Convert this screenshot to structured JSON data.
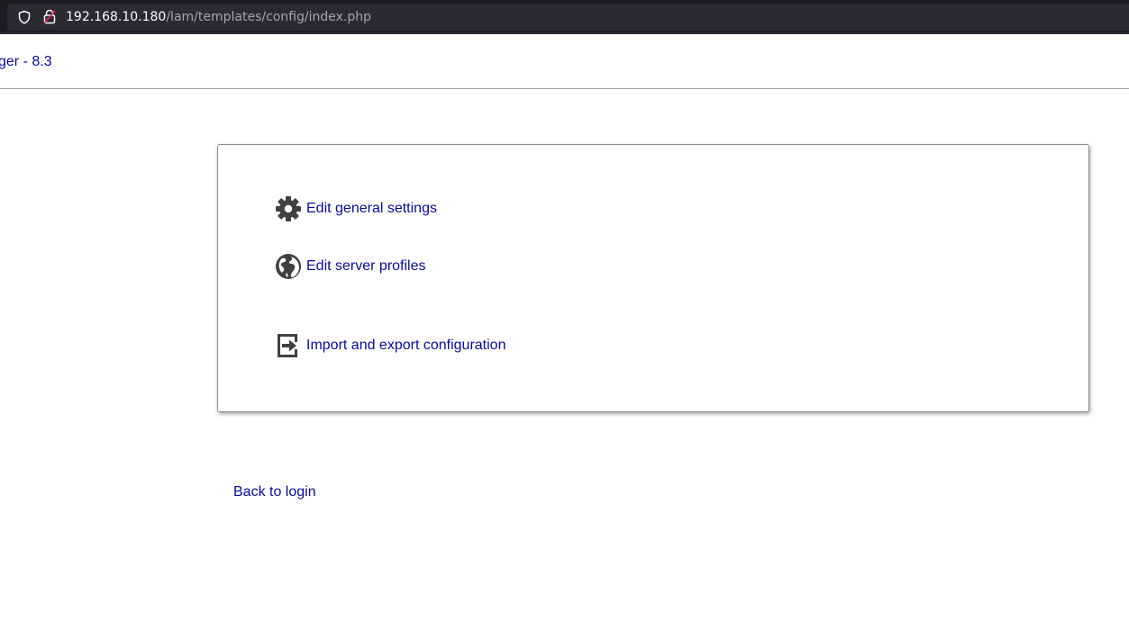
{
  "browser": {
    "url_host": "192.168.10.180",
    "url_path": "/lam/templates/config/index.php",
    "icons": [
      "shield-icon",
      "lock-icon"
    ]
  },
  "header": {
    "title": "ger - 8.3"
  },
  "config_menu": {
    "items": [
      {
        "label": "Edit general settings",
        "icon": "gear-icon"
      },
      {
        "label": "Edit server profiles",
        "icon": "globe-icon"
      },
      {
        "label": "Import and export configuration",
        "icon": "import-export-icon"
      }
    ]
  },
  "footer": {
    "back_label": "Back to login"
  },
  "colors": {
    "link": "#0b0b8f",
    "icon": "#404040",
    "browser_bar": "#1c1b22"
  }
}
